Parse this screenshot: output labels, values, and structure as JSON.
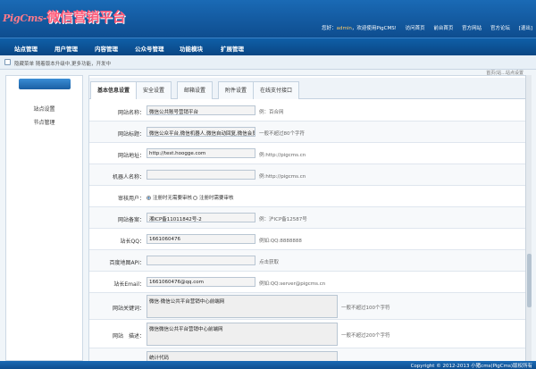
{
  "header": {
    "logo_en": "PigCms-",
    "logo_cn": "微信营销平台",
    "greeting": "您好：",
    "user": "admin",
    "welcome": "，欢迎使用PigCMS!",
    "links": [
      "访问首页",
      "前台首页",
      "官方网站",
      "官方论坛",
      "[退出]"
    ]
  },
  "nav": {
    "items": [
      "站点管理",
      "用户管理",
      "内容管理",
      "公众号管理",
      "功能模块",
      "扩展管理"
    ]
  },
  "notice": "隐藏菜单  随着版本升级中,更多功能，开发中",
  "sidebar": {
    "items": [
      "站点设置",
      "节点管理"
    ]
  },
  "breadcrumb": "首页(站...站点设置",
  "tabs": [
    "基本信息设置",
    "安全设置",
    "邮箱设置",
    "附件设置",
    "在线支付接口"
  ],
  "form": {
    "site_name": {
      "label": "网站名称：",
      "value": "微信公共账号营销平台",
      "tip": "例：百合网"
    },
    "site_title": {
      "label": "网站标题：",
      "value": "微信公众平台,微信机器人,微信自动回复,微信会员卡",
      "tip": "一般不超过80个字符"
    },
    "site_url": {
      "label": "网站地址：",
      "value": "http://test.hoogge.com",
      "tip": "例:http://pigcms.cn"
    },
    "robot_name": {
      "label": "机器人名称：",
      "value": "",
      "tip": "例:http://pigcms.cn"
    },
    "audit": {
      "label": "审核用户：",
      "opt1": "注册时无需要审核",
      "opt2": "注册时需要审核"
    },
    "icp": {
      "label": "网站备案：",
      "value": "湘ICP备11011842号-2",
      "tip": "例：沪ICP备12587号"
    },
    "qq": {
      "label": "站长QQ：",
      "value": "1661060476",
      "tip": "例如:QQ:8888888"
    },
    "baidu_map": {
      "label": "百度地图API：",
      "value": "",
      "tip": "点击获取"
    },
    "email": {
      "label": "站长Email：",
      "value": "1661060476@qq.com",
      "tip": "例如:QQ:server@pigcms.cn"
    },
    "keywords": {
      "label": "网站关键词：",
      "value": "微信·微信公共平台营销中心前端网",
      "tip": "一般不超过100个字符"
    },
    "description": {
      "label": "网站　描述：",
      "value": "微信微信公共平台营销中心前端网",
      "tip": "一般不超过200个字符"
    },
    "stats": {
      "label": "",
      "value": "统计代码"
    }
  },
  "footer": "Copyright © 2012-2013 小猪cms(PigCms)版权所有"
}
